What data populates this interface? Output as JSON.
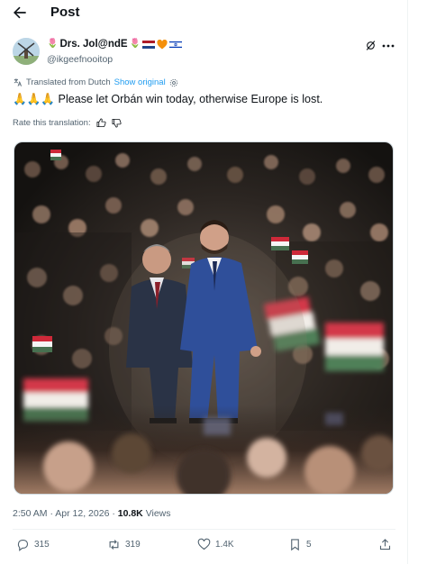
{
  "header": {
    "title": "Post"
  },
  "author": {
    "display_name": "Drs. Jol@ndE",
    "handle": "@ikgeefnooitop"
  },
  "translation": {
    "label": "Translated from Dutch",
    "show_original": "Show original"
  },
  "tweet": {
    "text": "🙏🙏🙏 Please let Orbán win today, otherwise Europe is lost."
  },
  "rate": {
    "label": "Rate this translation:"
  },
  "meta": {
    "timestamp": "2:50 AM · Apr 12, 2026 · ",
    "views_count": "10.8K",
    "views_label": " Views"
  },
  "actions": {
    "replies": "315",
    "reposts": "319",
    "likes": "1.4K",
    "bookmarks": "5"
  },
  "colors": {
    "accent": "#1d9bf0",
    "text": "#0f1419",
    "muted": "#536471",
    "suit_left": "#2a3346",
    "suit_right": "#2f4f9a",
    "flag_red": "#ce2939",
    "flag_green": "#477050"
  },
  "icons": {
    "back": "arrow-left-icon",
    "grok": "grok-icon",
    "more": "more-horizontal-icon",
    "translate": "translate-icon",
    "settings": "gear-icon",
    "thumbs_up": "thumbs-up-icon",
    "thumbs_down": "thumbs-down-icon",
    "reply": "reply-icon",
    "repost": "repost-icon",
    "like": "heart-icon",
    "bookmark": "bookmark-icon",
    "share": "share-icon"
  }
}
